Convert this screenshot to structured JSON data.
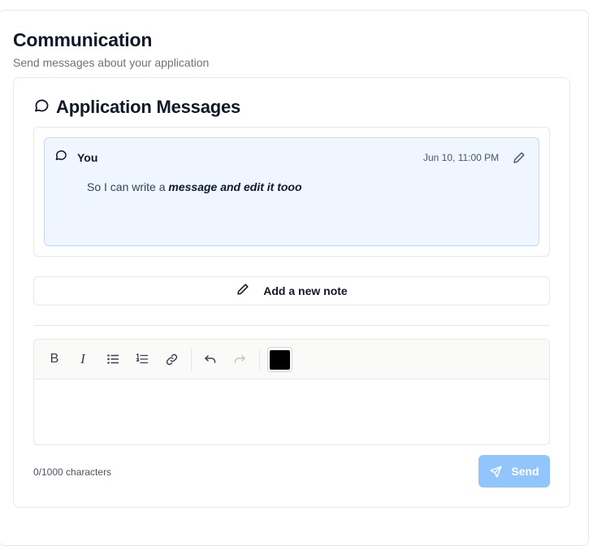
{
  "header": {
    "title": "Communication",
    "subtitle": "Send messages about your application"
  },
  "section": {
    "title": "Application Messages",
    "icon": "message-bubble-icon"
  },
  "messages": [
    {
      "author": "You",
      "timestamp": "Jun 10, 11:00 PM",
      "body_plain": "So I can write a ",
      "body_emphasis": "message and edit it tooo",
      "icon": "message-bubble-icon",
      "action_icon": "pencil-icon"
    }
  ],
  "add_note": {
    "label": "Add a new note",
    "icon": "pencil-icon"
  },
  "editor": {
    "toolbar": {
      "bold_glyph": "B",
      "italic_glyph": "I",
      "buttons": [
        "bold-icon",
        "italic-icon",
        "bullet-list-icon",
        "numbered-list-icon",
        "link-icon",
        "undo-icon",
        "redo-icon"
      ],
      "text_color": "#000000"
    },
    "content": ""
  },
  "footer": {
    "char_count": "0/1000 characters",
    "send_label": "Send",
    "send_icon": "send-icon"
  },
  "colors": {
    "message_bg": "#eff6ff",
    "message_border": "#bfdbfe",
    "send_button_bg": "#93c5fd",
    "border": "#e5e7eb",
    "toolbar_bg": "#fafaf9"
  }
}
